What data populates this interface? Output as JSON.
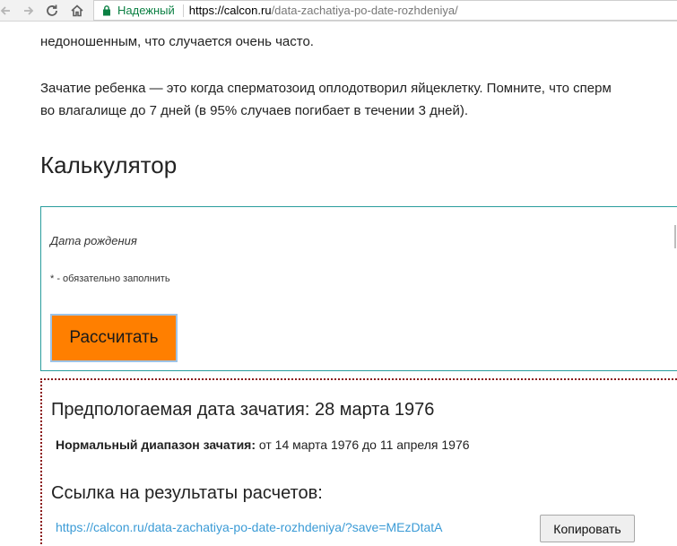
{
  "browser": {
    "secure_label": "Надежный",
    "url_host": "https://calcon.ru",
    "url_path": "/data-zachatiya-po-date-rozhdeniya/",
    "icons": [
      "back-arrow-icon",
      "forward-arrow-icon",
      "reload-icon",
      "home-icon",
      "lock-icon"
    ],
    "secure_color": "#0b8043"
  },
  "article": {
    "paragraph_1": "недоношенным, что случается очень часто.",
    "paragraph_2_line_1": "Зачатие ребенка — это когда сперматозоид оплодотворил яйцеклетку. Помните, что сперм",
    "paragraph_2_line_2": "во влагалище до 7 дней (в 95% случаев погибает в течении 3 дней).",
    "calculator_heading": "Калькулятор"
  },
  "calculator": {
    "birth_date_label": "Дата рождения",
    "required_note": "* - обязательно заполнить",
    "submit_label": "Рассчитать",
    "submit_color": "#ff7f00",
    "border_color": "#2a9d9d"
  },
  "result": {
    "estimated_date": "Предпологаемая дата зачатия: 28 марта 1976",
    "range_label": "Нормальный диапазон зачатия:",
    "range_value": " от 14 марта 1976 до 11 апреля 1976",
    "link_heading": "Ссылка на результаты расчетов:",
    "link_url": "https://calcon.ru/data-zachatiya-po-date-rozhdeniya/?save=MEzDtatA",
    "copy_label": "Копировать",
    "link_color": "#3b9bd6",
    "border_color": "#8b1a1a"
  }
}
